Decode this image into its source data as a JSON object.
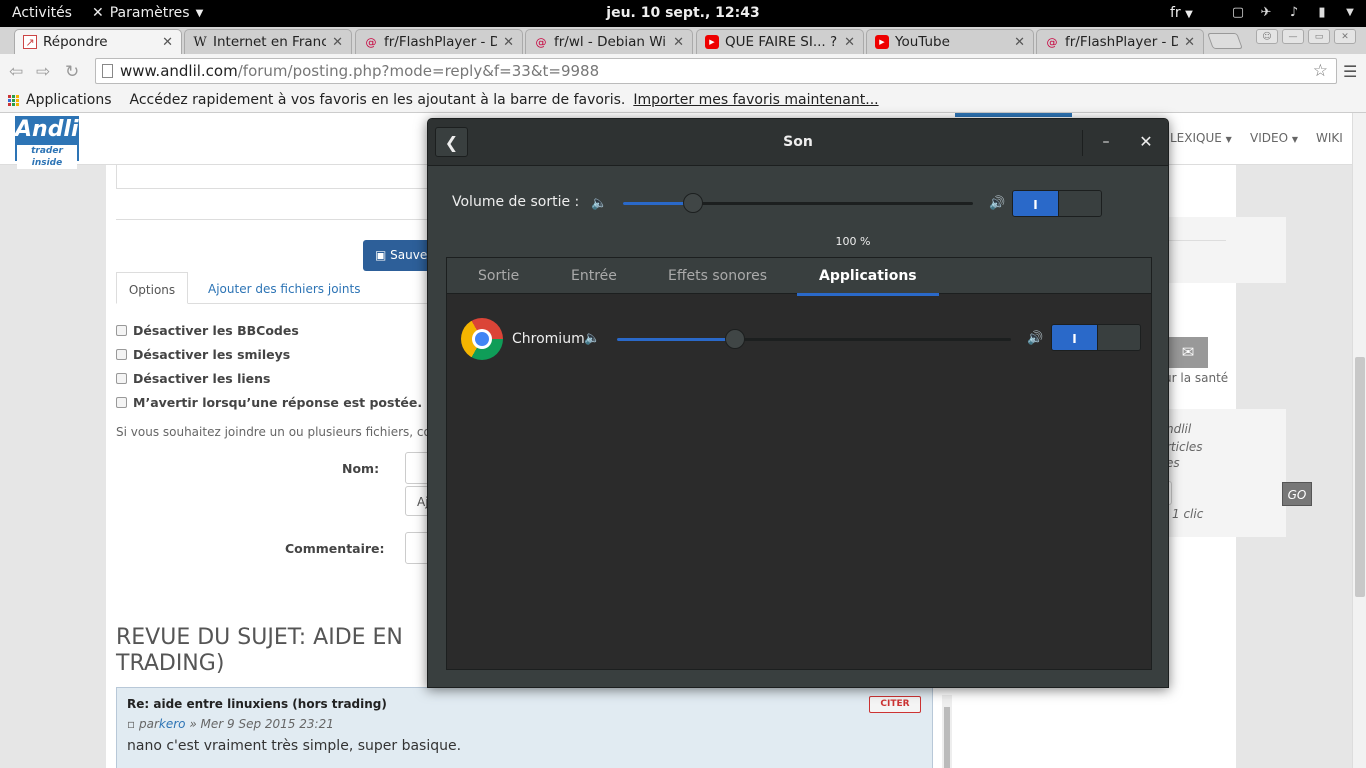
{
  "topbar": {
    "activities": "Activités",
    "app_menu": "Paramètres",
    "clock": "jeu. 10 sept., 12:43",
    "lang": "fr"
  },
  "tabs": [
    {
      "title": "Répondre",
      "icon": "page-icon"
    },
    {
      "title": "Internet en Franc",
      "icon": "wikipedia-icon"
    },
    {
      "title": "fr/FlashPlayer - D",
      "icon": "debian-icon"
    },
    {
      "title": "fr/wl - Debian Wi",
      "icon": "debian-icon"
    },
    {
      "title": "QUE FAIRE SI... ?",
      "icon": "youtube-icon"
    },
    {
      "title": "YouTube",
      "icon": "youtube-icon"
    },
    {
      "title": "fr/FlashPlayer - D",
      "icon": "debian-icon"
    }
  ],
  "address": {
    "host": "www.andlil.com",
    "path": "/forum/posting.php?mode=reply&f=33&t=9988"
  },
  "bookmarks": {
    "apps": "Applications",
    "hint": "Accédez rapidement à vos favoris en les ajoutant à la barre de favoris.",
    "import": "Importer mes favoris maintenant..."
  },
  "site": {
    "logo": "Andlil",
    "logo_tag": "trader inside",
    "nav": [
      "LEXIQUE",
      "VIDEO",
      "WIKI"
    ],
    "save_btn": "Sauveg",
    "tab_options": "Options",
    "tab_attach": "Ajouter des fichiers joints",
    "checkboxes": [
      "Désactiver les BBCodes",
      "Désactiver les smileys",
      "Désactiver les liens",
      "M’avertir lorsqu’une réponse est postée."
    ],
    "attach_info": "Si vous souhaitez joindre un ou plusieurs fichiers, comple",
    "name_label": "Nom:",
    "attach_btn": "Aj",
    "comment_label": "Commentaire:",
    "review_title_1": "REVUE DU SUJET: AIDE EN",
    "review_title_2": "TRADING)",
    "post": {
      "title": "Re: aide entre linuxiens (hors trading)",
      "meta_prefix": "par",
      "author": "kero",
      "date": "» Mer 9 Sep 2015 23:21",
      "body": "nano c'est vraiment très simple, super basique.",
      "quote": "CITER"
    },
    "side_sante": "ur la santé",
    "side_lines": [
      "ndlil",
      "rticles",
      "es"
    ],
    "go": "GO",
    "clic": "1 clic"
  },
  "sound": {
    "title": "Son",
    "output_label": "Volume de sortie :",
    "output_level": 0.2,
    "output_percent": "100 %",
    "output_toggle": "I",
    "tabs": [
      "Sortie",
      "Entrée",
      "Effets sonores",
      "Applications"
    ],
    "selected_tab": "Applications",
    "apps": [
      {
        "name": "Chromium",
        "level": 0.3,
        "toggle": "I"
      }
    ]
  },
  "colors": {
    "accent": "#2a69c9",
    "dialog_bg": "#393f3f",
    "brand": "#2d74b5"
  }
}
